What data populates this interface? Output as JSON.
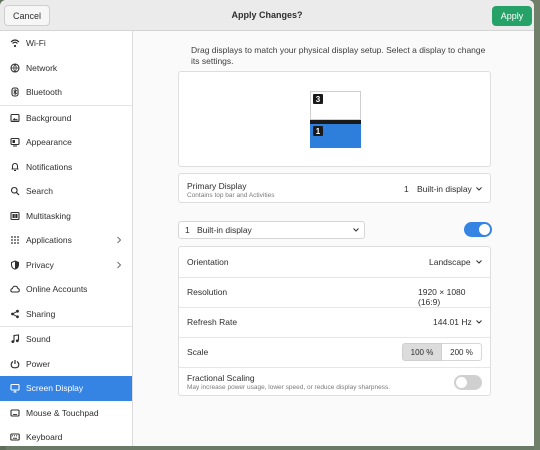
{
  "header": {
    "cancel_label": "Cancel",
    "title": "Apply Changes?",
    "apply_label": "Apply"
  },
  "sidebar": {
    "items": [
      {
        "label": "Wi-Fi",
        "icon": "wifi-icon"
      },
      {
        "label": "Network",
        "icon": "network-icon"
      },
      {
        "label": "Bluetooth",
        "icon": "bluetooth-icon"
      },
      {
        "label": "Background",
        "icon": "background-icon"
      },
      {
        "label": "Appearance",
        "icon": "appearance-icon"
      },
      {
        "label": "Notifications",
        "icon": "bell-icon"
      },
      {
        "label": "Search",
        "icon": "search-icon"
      },
      {
        "label": "Multitasking",
        "icon": "multitasking-icon"
      },
      {
        "label": "Applications",
        "icon": "apps-grid-icon"
      },
      {
        "label": "Privacy",
        "icon": "privacy-icon"
      },
      {
        "label": "Online Accounts",
        "icon": "cloud-icon"
      },
      {
        "label": "Sharing",
        "icon": "share-icon"
      },
      {
        "label": "Sound",
        "icon": "music-note-icon"
      },
      {
        "label": "Power",
        "icon": "power-icon"
      },
      {
        "label": "Screen Display",
        "icon": "display-icon"
      },
      {
        "label": "Mouse & Touchpad",
        "icon": "mouse-icon"
      },
      {
        "label": "Keyboard",
        "icon": "keyboard-icon"
      }
    ]
  },
  "main": {
    "description": "Drag displays to match your physical display setup. Select a display to change its settings.",
    "monitor_badges": [
      "3",
      "1"
    ],
    "primary_display": {
      "label": "Primary Display",
      "sublabel": "Contains top bar and Activities",
      "number": "1",
      "value": "Built-in display"
    },
    "display_selector": {
      "number": "1",
      "value": "Built-in display"
    },
    "settings": {
      "orientation_label": "Orientation",
      "orientation_value": "Landscape",
      "resolution_label": "Resolution",
      "resolution_value": "1920 × 1080 (16:9)",
      "refresh_label": "Refresh Rate",
      "refresh_value": "144.01 Hz",
      "scale_label": "Scale",
      "scale_options": [
        "100 %",
        "200 %"
      ],
      "fractional_label": "Fractional Scaling",
      "fractional_sublabel": "May increase power usage, lower speed, or reduce display sharpness."
    }
  },
  "colors": {
    "accent": "#3584e4",
    "apply": "#26a269"
  }
}
